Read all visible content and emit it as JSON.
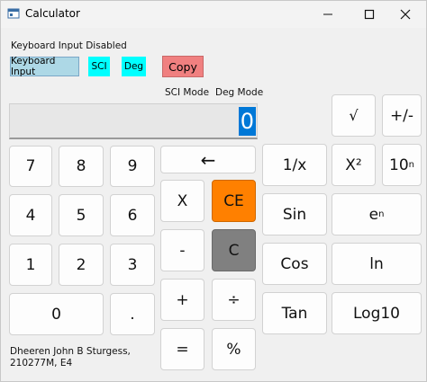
{
  "window": {
    "title": "Calculator",
    "controls": [
      "minimize",
      "maximize",
      "close"
    ]
  },
  "status": {
    "keyboard_input": "Keyboard Input Disabled",
    "sci_mode_label": "SCI Mode",
    "deg_mode_label": "Deg Mode"
  },
  "toolbar": {
    "keyboard_input_button": "Keyboard Input",
    "sci_button": "SCI",
    "deg_button": "Deg",
    "copy_button": "Copy"
  },
  "display": {
    "value": "0"
  },
  "keys": {
    "n7": "7",
    "n8": "8",
    "n9": "9",
    "n4": "4",
    "n5": "5",
    "n6": "6",
    "n1": "1",
    "n2": "2",
    "n3": "3",
    "n0": "0",
    "dot": ".",
    "backspace": "←",
    "multiply": "X",
    "ce": "CE",
    "minus": "-",
    "clear": "C",
    "plus": "+",
    "divide": "÷",
    "equals": "=",
    "percent": "%",
    "sqrt": "√",
    "negate": "+/-",
    "reciprocal": "1/x",
    "square": "X²",
    "ten_pow_base": "10",
    "ten_pow_exp": "n",
    "sin": "Sin",
    "e_pow_base": "e",
    "e_pow_exp": "n",
    "cos": "Cos",
    "ln": "ln",
    "tan": "Tan",
    "log10": "Log10"
  },
  "credit": {
    "line1": "Dheeren John B Sturgess,",
    "line2": "210277M, E4"
  },
  "colors": {
    "sci_button": "#00ffff",
    "deg_button": "#00ffff",
    "copy_button": "#f08080",
    "keyboard_button": "#add8e6",
    "ce_key": "#ff8000",
    "c_key": "#808080",
    "display_highlight": "#0078d7"
  }
}
